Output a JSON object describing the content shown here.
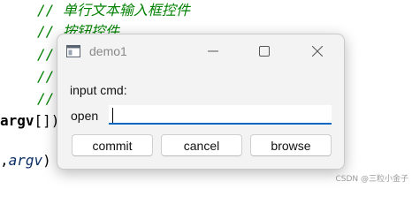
{
  "code_editor": {
    "lines": [
      {
        "prefix": "",
        "text": "// 单行文本输入框控件"
      },
      {
        "prefix": "",
        "text": "// 按钮控件"
      },
      {
        "prefix": "",
        "text": "//"
      },
      {
        "prefix": "",
        "text": "//"
      },
      {
        "prefix": "",
        "text": "//"
      }
    ],
    "argv_line": {
      "keyword": "argv",
      "rest": "[])"
    },
    "call_line": {
      "start": ",",
      "param": "argv",
      "end": ")"
    }
  },
  "dialog": {
    "title": "demo1",
    "label_cmd": "input cmd:",
    "label_open": "open",
    "input_value": "",
    "buttons": {
      "commit": "commit",
      "cancel": "cancel",
      "browse": "browse"
    }
  },
  "watermark": "CSDN @三粒小金子",
  "colors": {
    "accent": "#0067c0",
    "comment": "#008000",
    "dialog_bg": "#f3f3f3"
  }
}
